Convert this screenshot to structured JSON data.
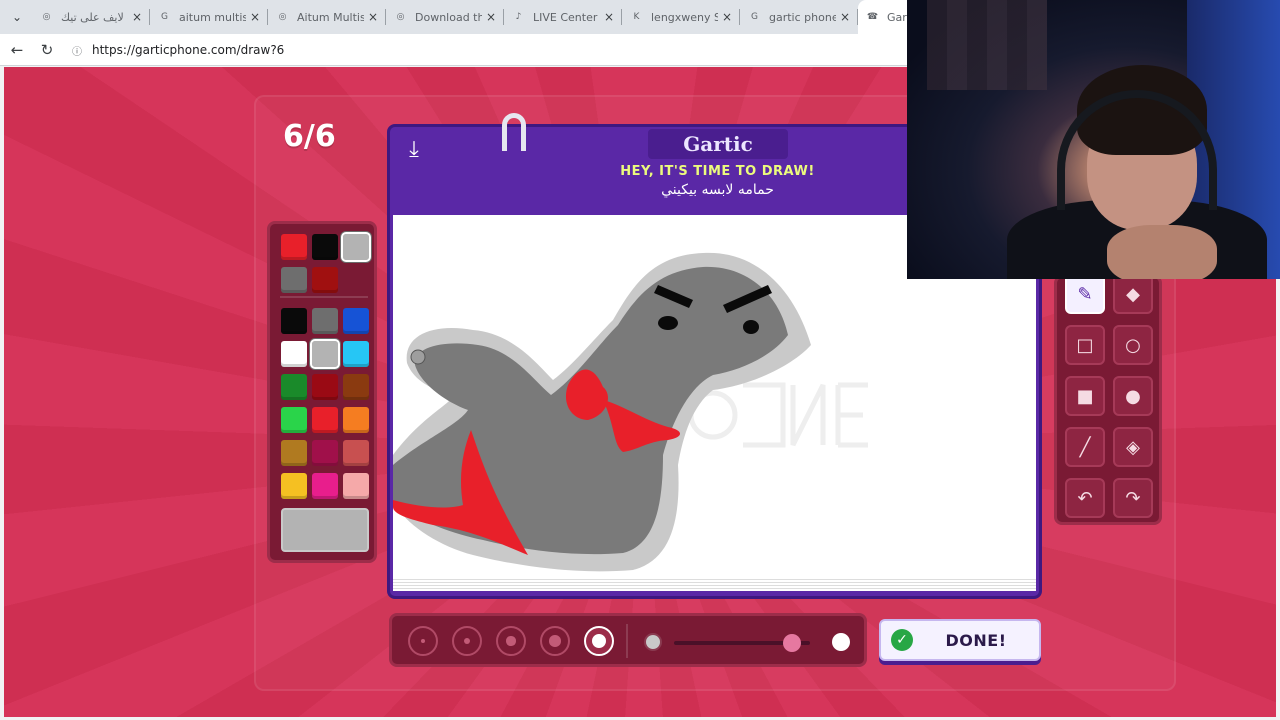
{
  "browser": {
    "tabs": [
      {
        "title": "بث لايف على تيك",
        "icon": "globe-icon"
      },
      {
        "title": "aitum multistream",
        "icon": "search-icon"
      },
      {
        "title": "Aitum Multistream",
        "icon": "globe-icon"
      },
      {
        "title": "Download the Aitum",
        "icon": "globe-icon"
      },
      {
        "title": "LIVE Center",
        "icon": "tiktok-icon"
      },
      {
        "title": "lengxweny Stream",
        "icon": "kick-icon"
      },
      {
        "title": "gartic phone - Google",
        "icon": "search-icon"
      },
      {
        "title": "Gartic",
        "icon": "gartic-icon",
        "active": true
      }
    ],
    "url": "https://garticphone.com/draw?6"
  },
  "game": {
    "round": "6/6",
    "logo": "Gartic",
    "prompt_header": "HEY, IT'S TIME TO DRAW!",
    "prompt_text": "حمامه لابسه بيكيني",
    "done_label": "DONE!",
    "palette_top": [
      "#e8202a",
      "#0a0a0a",
      "#b3b3b3",
      "#6e6e6e",
      "#a01010"
    ],
    "palette": [
      "#0a0a0a",
      "#6e6e6e",
      "#1653d6",
      "#ffffff",
      "#b3b3b3",
      "#26c6f5",
      "#1a8a2a",
      "#9a0a14",
      "#8a3a10",
      "#2ad44a",
      "#e8202a",
      "#f57d21",
      "#b07a20",
      "#a0104a",
      "#c85050",
      "#f5c022",
      "#e81e8c",
      "#f5a9a9"
    ],
    "selected_color": "#b3b3b3",
    "tools": [
      "pen-icon",
      "eraser-icon",
      "rectangle-outline-icon",
      "ellipse-outline-icon",
      "rectangle-fill-icon",
      "ellipse-fill-icon",
      "line-icon",
      "fill-bucket-icon",
      "undo-icon",
      "redo-icon"
    ],
    "selected_tool": "pen-icon",
    "brush_sizes": [
      1,
      2,
      3,
      4,
      5
    ],
    "selected_size": 5,
    "opacity": 0.87
  }
}
